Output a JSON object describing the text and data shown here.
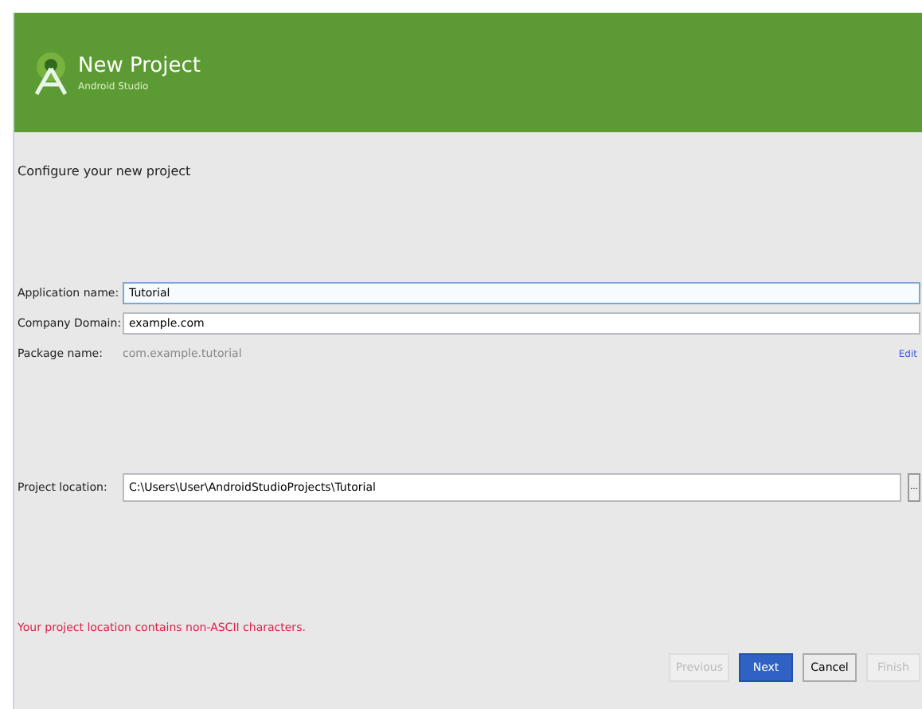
{
  "header": {
    "title": "New Project",
    "subtitle": "Android Studio"
  },
  "heading": "Configure your new project",
  "fields": [
    {
      "label": "Application name:",
      "value": "Tutorial",
      "focused": true
    },
    {
      "label": "Company Domain:",
      "value": "example.com",
      "focused": false
    }
  ],
  "package": {
    "label": "Package name:",
    "value": "com.example.tutorial",
    "link": "Edit"
  },
  "location": {
    "label": "Project location:",
    "value": "C:\\Users\\User\\AndroidStudioProjects\\Tutorial",
    "browse": "..."
  },
  "error": "Your project location contains non-ASCII characters.",
  "buttons": [
    {
      "label": "Previous",
      "kind": "normal",
      "disabled": true
    },
    {
      "label": "Next",
      "kind": "primary",
      "disabled": false
    },
    {
      "label": "Cancel",
      "kind": "normal",
      "disabled": false
    },
    {
      "label": "Finish",
      "kind": "normal",
      "disabled": true
    }
  ]
}
